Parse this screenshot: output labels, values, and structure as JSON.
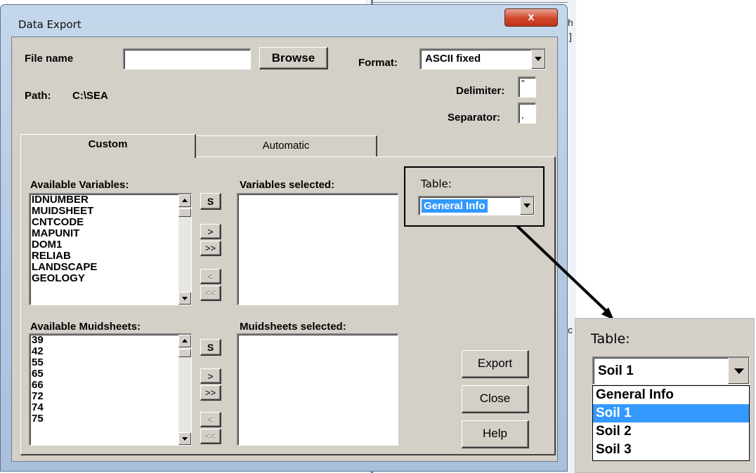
{
  "window": {
    "title": "Data Export",
    "close_glyph": "x"
  },
  "background_window": {
    "fragments": [
      "h",
      "]",
      "c"
    ]
  },
  "file": {
    "file_name_label": "File name",
    "file_name_value": "",
    "browse_label": "Browse",
    "format_label": "Format:",
    "format_value": "ASCII fixed",
    "path_label": "Path:",
    "path_value": "C:\\SEA",
    "delimiter_label": "Delimiter:",
    "delimiter_value": "\"",
    "separator_label": "Separator:",
    "separator_value": ","
  },
  "tabs": [
    {
      "label": "Custom",
      "active": true
    },
    {
      "label": "Automatic",
      "active": false
    }
  ],
  "variables": {
    "available_label": "Available Variables:",
    "available_items": [
      "IDNUMBER",
      "MUIDSHEET",
      "CNTCODE",
      "MAPUNIT",
      "DOM1",
      "RELIAB",
      "LANDSCAPE",
      "GEOLOGY"
    ],
    "selected_label": "Variables selected:",
    "selected_items": []
  },
  "muidsheets": {
    "available_label": "Available Muidsheets:",
    "available_items": [
      "39",
      "42",
      "55",
      "65",
      "66",
      "72",
      "74",
      "75"
    ],
    "selected_label": "Muidsheets selected:",
    "selected_items": []
  },
  "move_buttons": {
    "select": "S",
    "add": ">",
    "add_all": ">>",
    "remove": "<",
    "remove_all": "<<"
  },
  "table": {
    "label": "Table:",
    "value": "General Info"
  },
  "actions": {
    "export": "Export",
    "close": "Close",
    "help": "Help"
  },
  "zoom_inset": {
    "label": "Table:",
    "value": "Soil 1",
    "options": [
      "General Info",
      "Soil 1",
      "Soil 2",
      "Soil 3"
    ],
    "highlighted": "Soil 1"
  },
  "colors": {
    "selection": "#3399ff",
    "dialog_face": "#d4d0c8",
    "title_bar": "#b9cfe8",
    "close_button": "#c8452a"
  }
}
